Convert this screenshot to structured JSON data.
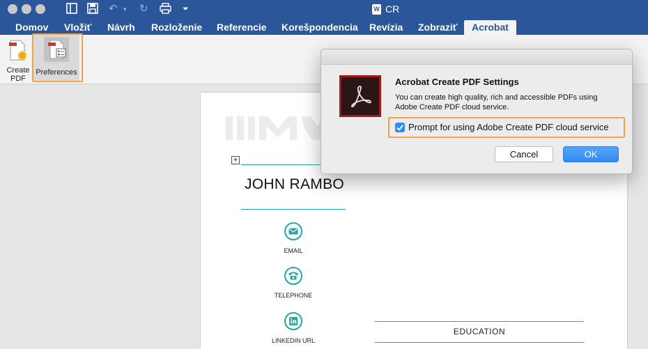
{
  "window": {
    "title": "CR"
  },
  "tabs": [
    {
      "label": "Domov"
    },
    {
      "label": "Vložiť"
    },
    {
      "label": "Návrh"
    },
    {
      "label": "Rozloženie"
    },
    {
      "label": "Referencie"
    },
    {
      "label": "Korešpondencia"
    },
    {
      "label": "Revízia"
    },
    {
      "label": "Zobraziť"
    },
    {
      "label": "Acrobat"
    }
  ],
  "active_tab": "Acrobat",
  "ribbon": {
    "create_pdf": "Create PDF",
    "preferences": "Preferences"
  },
  "dialog": {
    "title": "Acrobat Create PDF Settings",
    "description": "You can create high quality, rich and accessible PDFs using Adobe Create PDF cloud service.",
    "checkbox_label": "Prompt for using Adobe Create PDF cloud service",
    "checkbox_checked": true,
    "cancel": "Cancel",
    "ok": "OK"
  },
  "document": {
    "name": "JOHN RAMBO",
    "contacts": [
      {
        "label": "EMAIL",
        "icon": "envelope-icon"
      },
      {
        "label": "TELEPHONE",
        "icon": "phone-icon"
      },
      {
        "label": "LINKEDIN URL",
        "icon": "linkedin-icon"
      }
    ],
    "education_heading": "EDUCATION"
  },
  "colors": {
    "brand": "#2b579a",
    "highlight": "#f5a243",
    "teal": "#27a6a6",
    "ok_button": "#2f8cf5"
  }
}
